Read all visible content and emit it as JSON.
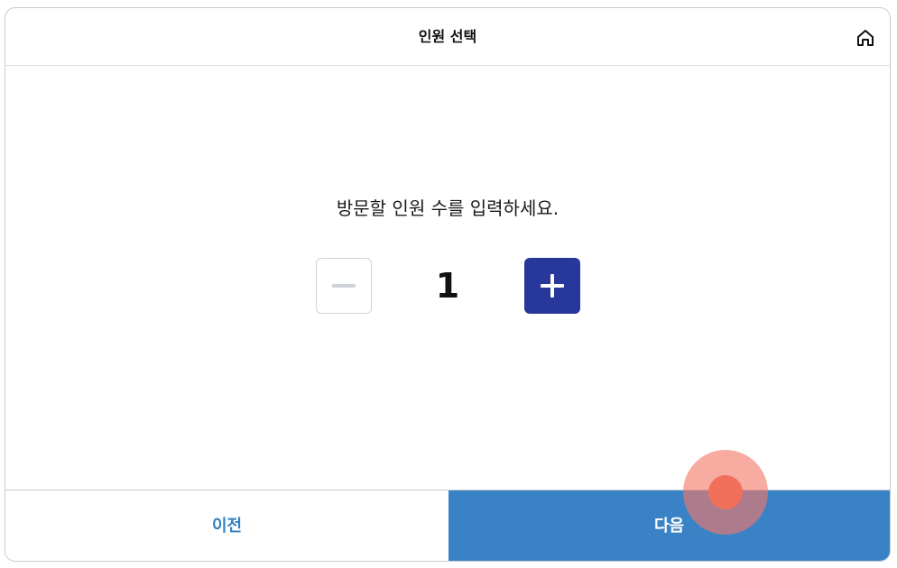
{
  "header": {
    "title": "인원 선택",
    "home_icon": "home-icon"
  },
  "main": {
    "prompt": "방문할 인원 수를 입력하세요.",
    "count": "1",
    "minus_icon": "minus-icon",
    "plus_icon": "plus-icon"
  },
  "footer": {
    "prev_label": "이전",
    "next_label": "다음"
  },
  "colors": {
    "primary_dark": "#27379a",
    "primary": "#3a82c6",
    "link": "#2f80c5",
    "touch_indicator": "#f0705c"
  }
}
